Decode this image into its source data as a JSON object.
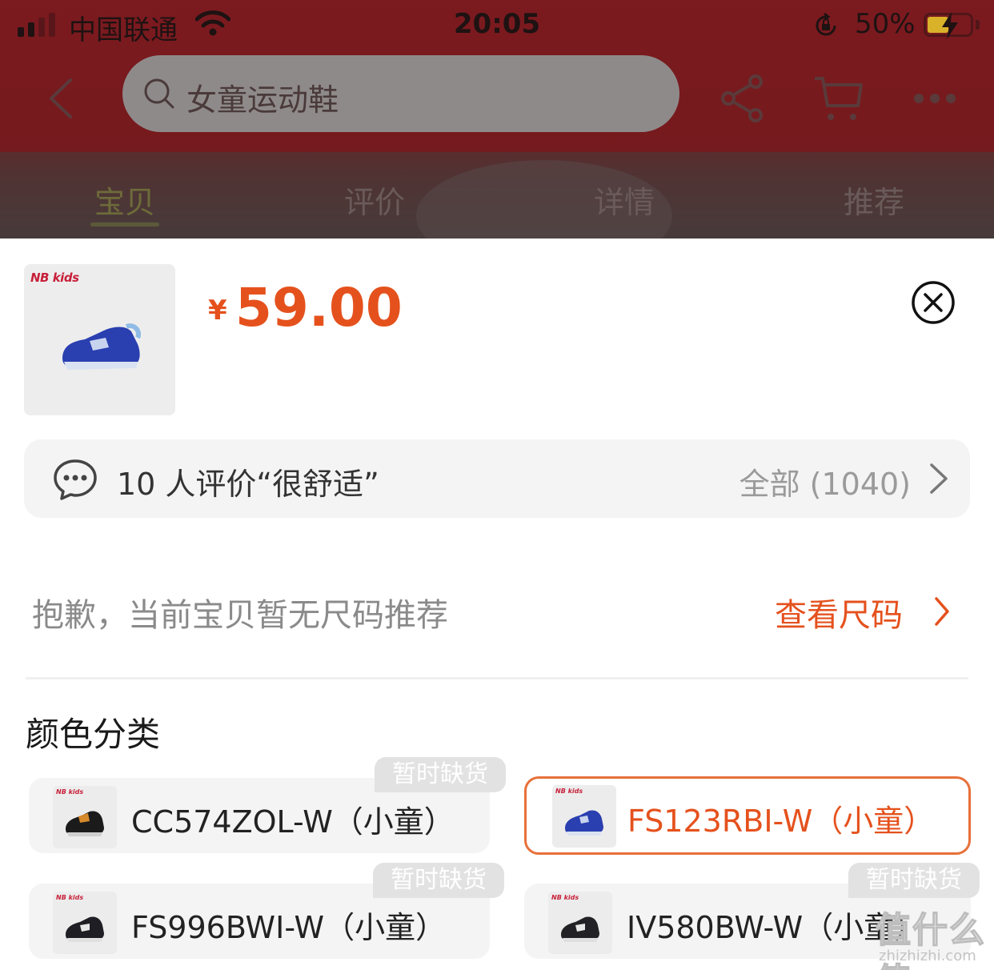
{
  "status_bar": {
    "carrier": "中国联通",
    "time": "20:05",
    "battery_percent": "50%",
    "battery_level": 0.5,
    "signal_bars": 2
  },
  "nav": {
    "search_placeholder": "女童运动鞋",
    "icons": [
      "back-icon",
      "search-icon",
      "share-icon",
      "cart-icon",
      "more-icon"
    ]
  },
  "tabs": [
    {
      "label": "宝贝",
      "active": true
    },
    {
      "label": "评价",
      "active": false
    },
    {
      "label": "详情",
      "active": false
    },
    {
      "label": "推荐",
      "active": false
    }
  ],
  "product": {
    "brand_logo": "NB kids",
    "currency": "¥",
    "price": "59.00"
  },
  "review": {
    "summary": "10 人评价“很舒适”",
    "all_label": "全部 (1040)"
  },
  "size": {
    "note": "抱歉，当前宝贝暂无尺码推荐",
    "link": "查看尺码"
  },
  "color_section": {
    "title": "颜色分类",
    "options": [
      {
        "label": "CC574ZOL-W（小童）",
        "out_of_stock": true,
        "selected": false,
        "badge": "暂时缺货"
      },
      {
        "label": "FS123RBI-W（小童）",
        "out_of_stock": false,
        "selected": true,
        "badge": ""
      },
      {
        "label": "FS996BWI-W（小童）",
        "out_of_stock": true,
        "selected": false,
        "badge": "暂时缺货"
      },
      {
        "label": "IV580BW-W（小童）",
        "out_of_stock": true,
        "selected": false,
        "badge": "暂时缺货"
      }
    ]
  },
  "watermark": {
    "main": "值什么值",
    "sub": "zhizhizhi.com"
  },
  "colors": {
    "accent": "#e5511d",
    "selected_border": "#e8703a",
    "header_bg": "#7b1a1f"
  }
}
